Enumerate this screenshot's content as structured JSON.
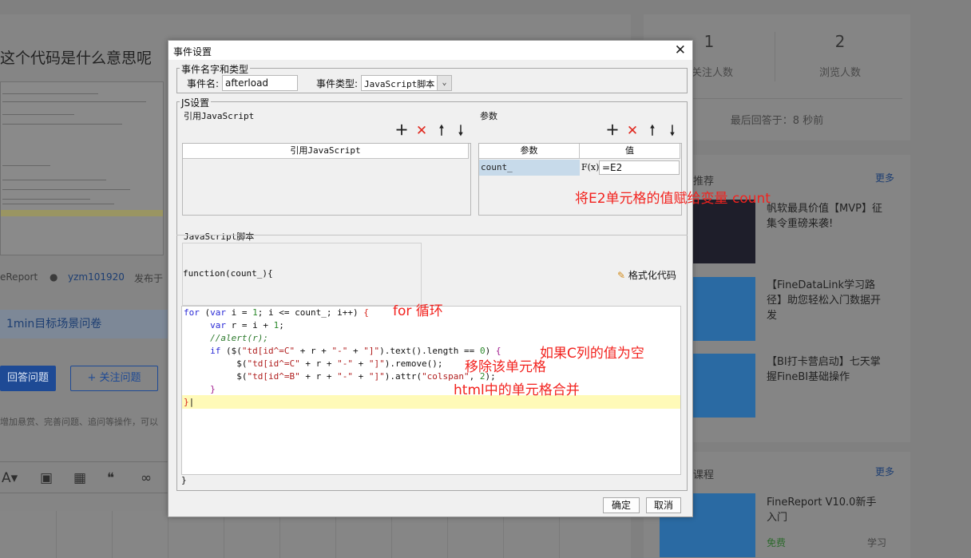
{
  "background": {
    "question_title": "这个代码是什么意思呢",
    "author": "eReport",
    "user": "yzm101920",
    "published": "发布于",
    "survey": "1min目标场景问卷",
    "answer_button": "回答问题",
    "follow_button": "+ 关注问题",
    "hint": "增加悬赏、完善问题、追问等操作，可以",
    "stats": [
      {
        "value": "1",
        "label": "关注人数"
      },
      {
        "value": "2",
        "label": "浏览人数"
      }
    ],
    "last_answer": "最后回答于：8 秒前",
    "recommend": {
      "head": "推荐",
      "more": "更多",
      "items": [
        {
          "text": "帆软最具价值【MVP】征集令重磅来袭!"
        },
        {
          "text": "【FineDataLink学习路径】助您轻松入门数据开发"
        },
        {
          "text": "【BI打卡营启动】七天掌握FineBI基础操作"
        }
      ]
    },
    "courses": {
      "head": "课程",
      "more": "更多",
      "item_text": "FineReport V10.0新手入门",
      "free": "免费",
      "learn": "学习"
    }
  },
  "dialog": {
    "title": "事件设置",
    "event_group_label": "事件名字和类型",
    "event_name_label": "事件名:",
    "event_name_value": "afterload",
    "event_type_label": "事件类型:",
    "event_type_value": "JavaScript脚本",
    "js_group_label": "JS设置",
    "ref_js_label": "引用JavaScript",
    "ref_js_column": "引用JavaScript",
    "params_label": "参数",
    "params_columns": [
      "参数",
      "值"
    ],
    "param_name": "count_",
    "param_value": "=E2",
    "fx_label": "F(x)",
    "script_label": "JavaScript脚本",
    "function_header": "function(count_){",
    "format_code_label": "格式化代码",
    "code_end": "}",
    "ok_label": "确定",
    "cancel_label": "取消"
  },
  "annotations": {
    "assign": "将E2单元格的值赋给变量 count",
    "loop": "for 循环",
    "if_empty": "如果C列的值为空",
    "remove": "移除该单元格",
    "merge": "html中的单元格合并"
  },
  "code": {
    "lines": [
      "for (var i = 1; i <= count_; i++) {",
      "    var r = i + 1;",
      "    //alert(r);",
      "    if ($(\"td[id^=C\" + r + \"-\" + \"]\").text().length == 0) {",
      "        $(\"td[id^=C\" + r + \"-\" + \"]\").remove();",
      "        $(\"td[id^=B\" + r + \"-\" + \"]\").attr(\"colspan\", 2);",
      "    }",
      "}"
    ]
  },
  "colors": {
    "annotation": "#f2221e",
    "keyword": "#2a2ad6",
    "string": "#b01e1e",
    "comment": "#2d7a2d",
    "highlight_line": "#fffab8",
    "delete_icon": "#e0281e"
  },
  "icons": [
    "add-icon",
    "delete-icon",
    "arrow-up-icon",
    "arrow-down-icon",
    "close-icon",
    "broom-icon",
    "fx-icon",
    "chevron-down-icon"
  ]
}
